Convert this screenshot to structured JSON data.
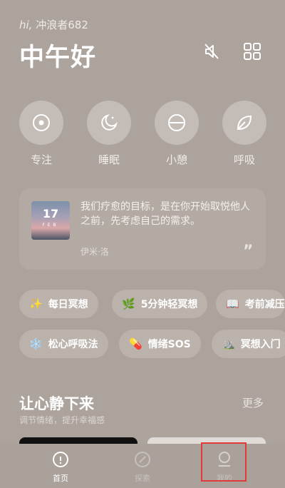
{
  "header": {
    "greeting_prefix": "hi,",
    "user_name": "冲浪者682",
    "greeting": "中午好",
    "icons": [
      "mute-speaker-icon",
      "grid-icon"
    ]
  },
  "modes": [
    {
      "label": "专注",
      "icon": "focus-target-icon"
    },
    {
      "label": "睡眠",
      "icon": "moon-icon"
    },
    {
      "label": "小憩",
      "icon": "half-circle-icon"
    },
    {
      "label": "呼吸",
      "icon": "leaf-icon"
    }
  ],
  "quote": {
    "day": "17",
    "month": "FEB",
    "text": "我们疗愈的目标，是在你开始取悦他人之前，先考虑自己的需求。",
    "author": "伊米·洛",
    "mark": "”"
  },
  "tags": [
    {
      "emoji": "✨",
      "label": "每日冥想"
    },
    {
      "emoji": "🌿",
      "label": "5分钟轻冥想"
    },
    {
      "emoji": "📖",
      "label": "考前减压"
    },
    {
      "emoji": "❄️",
      "label": "松心呼吸法"
    },
    {
      "emoji": "💊",
      "label": "情绪SOS"
    },
    {
      "emoji": "⛰️",
      "label": "冥想入门"
    }
  ],
  "section": {
    "title": "让心静下来",
    "subtitle": "调节情绪，提升幸福感",
    "more": "更多"
  },
  "tabbar": {
    "home": "首页",
    "explore": "探索",
    "mine": "我的"
  },
  "colors": {
    "background": "#ada39d",
    "highlight": "#e03a3a"
  }
}
